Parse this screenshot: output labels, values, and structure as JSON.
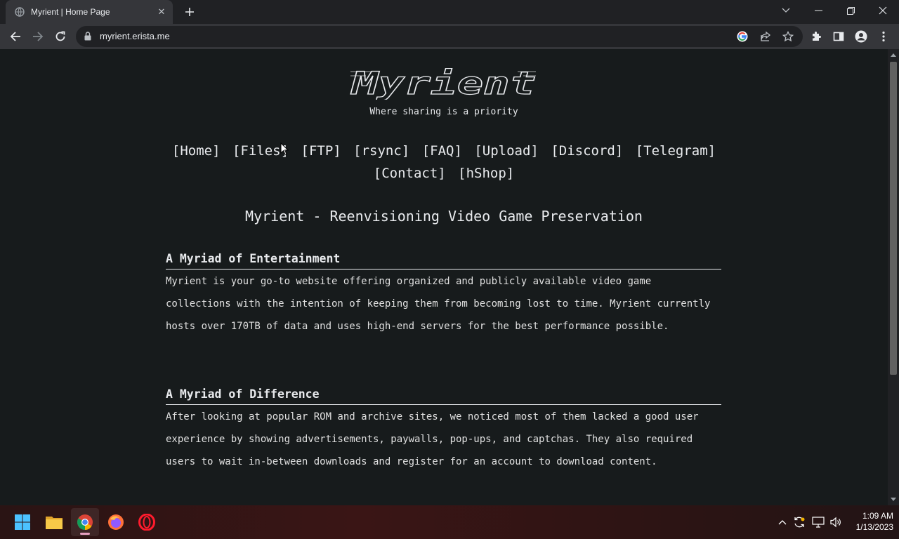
{
  "browser": {
    "tab_title": "Myrient | Home Page",
    "url": "myrient.erista.me"
  },
  "page": {
    "logo_text": "Myrient",
    "tagline": "Where sharing is a priority",
    "nav": [
      "[Home]",
      "[Files]",
      "[FTP]",
      "[rsync]",
      "[FAQ]",
      "[Upload]",
      "[Discord]",
      "[Telegram]",
      "[Contact]",
      "[hShop]"
    ],
    "headline": "Myrient - Reenvisioning Video Game Preservation",
    "sections": [
      {
        "title": "A Myriad of Entertainment",
        "body": "Myrient is your go-to website offering organized and publicly available video game collections with the intention of keeping them from becoming lost to time. Myrient currently hosts over 170TB of data and uses high-end servers for the best performance possible."
      },
      {
        "title": "A Myriad of Difference",
        "body": "After looking at popular ROM and archive sites, we noticed most of them lacked a good user experience by showing advertisements, paywalls, pop-ups, and captchas. They also required users to wait in-between downloads and register for an account to download content."
      }
    ]
  },
  "taskbar": {
    "apps": [
      "start-icon",
      "file-explorer-icon",
      "chrome-icon",
      "firefox-icon",
      "opera-icon"
    ],
    "time": "1:09 AM",
    "date": "1/13/2023"
  },
  "colors": {
    "page_bg": "#171b1c",
    "text": "#e8eaed",
    "chrome_dark": "#202124",
    "chrome_mid": "#35363a"
  }
}
